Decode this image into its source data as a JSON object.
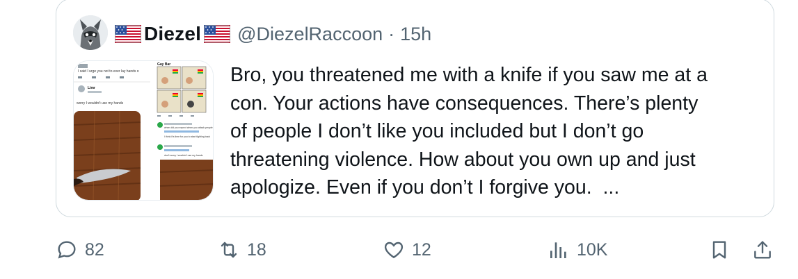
{
  "quote": {
    "author": {
      "display_name": "Diezel",
      "handle": "@DiezelRaccoon",
      "separator": "·",
      "time": "15h",
      "flag_icon": "us-flag-icon"
    },
    "text": "Bro, you threatened me with a knife if you saw me at a\ncon. Your actions have consequences. There’s plenty\nof people I don’t like you included but I don’t go\nthreatening violence. How about you own up and just\napologize. Even if you don’t I forgive you.  ...",
    "media": {
      "thumb_snippets": {
        "top_caption": "I said I urge you not to ever lay hands o",
        "user_name": "Limr",
        "reply_line": "worry I wouldn't use my hands",
        "gay_bar": "Gay Bar",
        "side_reply": "when did you expect when you attack people",
        "side_reply2": "I think it's time for you to start fighting back",
        "side_bottom": "don't worry I wouldn't use my hands"
      }
    }
  },
  "actions": {
    "reply_count": "82",
    "repost_count": "18",
    "like_count": "12",
    "views_count": "10K"
  },
  "colors": {
    "text_primary": "#0f1419",
    "text_secondary": "#536471",
    "border": "#cfd9de"
  }
}
